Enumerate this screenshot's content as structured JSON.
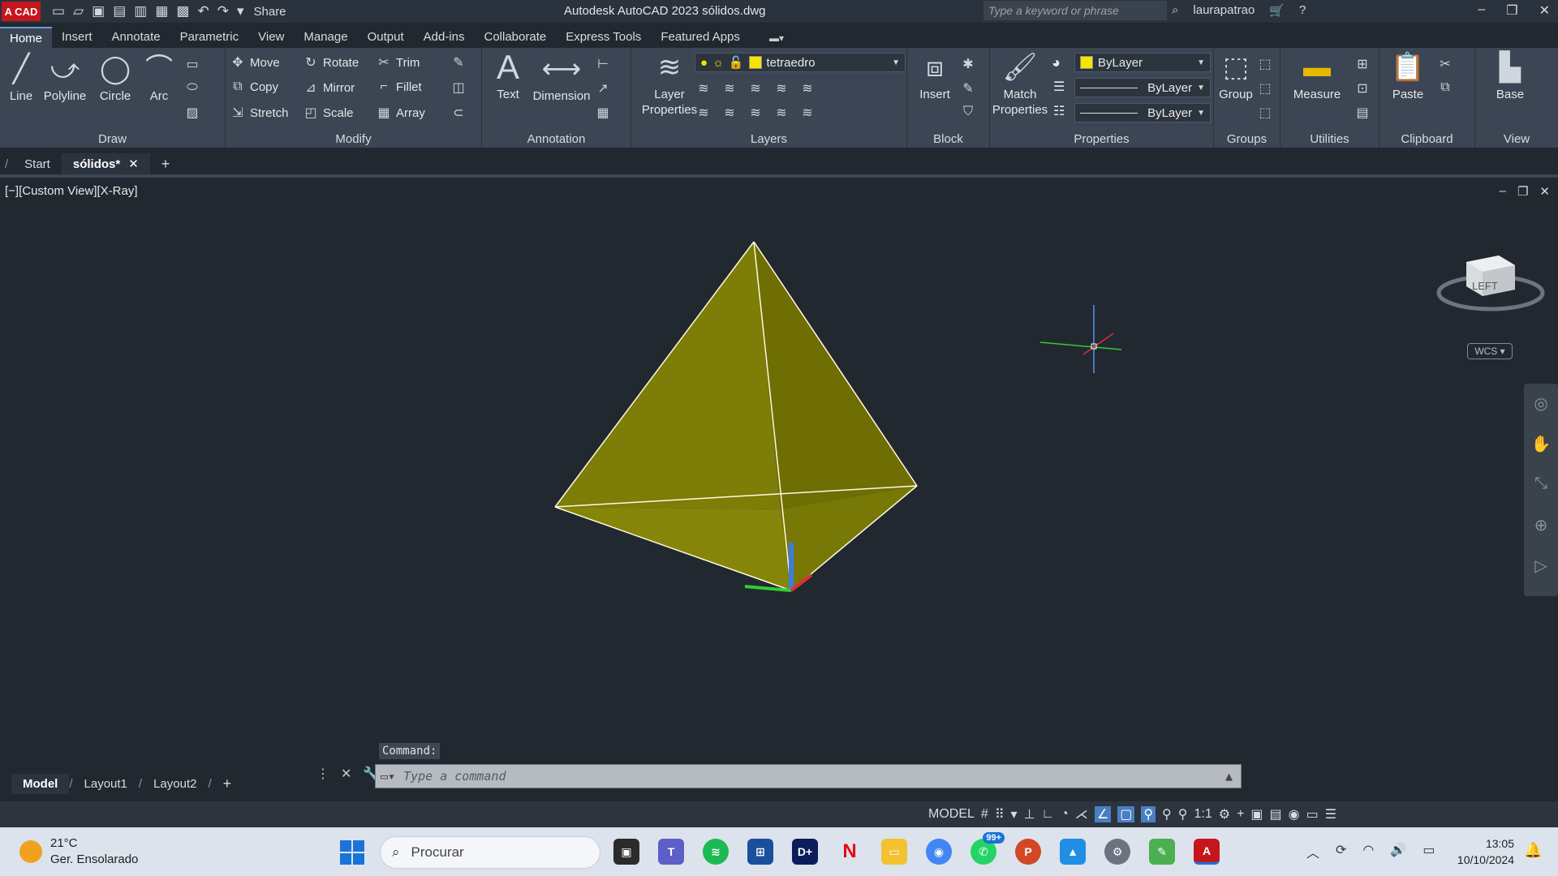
{
  "titlebar": {
    "logo": "A CAD",
    "share": "Share",
    "app_title": "Autodesk AutoCAD 2023   sólidos.dwg",
    "search_placeholder": "Type a keyword or phrase",
    "user": "laurapatrao"
  },
  "ribbon_tabs": [
    "Home",
    "Insert",
    "Annotate",
    "Parametric",
    "View",
    "Manage",
    "Output",
    "Add-ins",
    "Collaborate",
    "Express Tools",
    "Featured Apps"
  ],
  "ribbon": {
    "draw": {
      "title": "Draw",
      "line": "Line",
      "polyline": "Polyline",
      "circle": "Circle",
      "arc": "Arc"
    },
    "modify": {
      "title": "Modify",
      "move": "Move",
      "rotate": "Rotate",
      "trim": "Trim",
      "copy": "Copy",
      "mirror": "Mirror",
      "fillet": "Fillet",
      "stretch": "Stretch",
      "scale": "Scale",
      "array": "Array"
    },
    "annotation": {
      "title": "Annotation",
      "text": "Text",
      "dimension": "Dimension"
    },
    "layers": {
      "title": "Layers",
      "layer_properties_1": "Layer",
      "layer_properties_2": "Properties",
      "current_layer": "tetraedro"
    },
    "block": {
      "title": "Block",
      "insert": "Insert"
    },
    "properties": {
      "title": "Properties",
      "match_1": "Match",
      "match_2": "Properties",
      "color": "ByLayer",
      "linetype": "ByLayer",
      "lineweight": "ByLayer"
    },
    "groups": {
      "title": "Groups",
      "group": "Group"
    },
    "utilities": {
      "title": "Utilities",
      "measure": "Measure"
    },
    "clipboard": {
      "title": "Clipboard",
      "paste": "Paste"
    },
    "view": {
      "title": "View",
      "base": "Base"
    }
  },
  "doc_tabs": {
    "start": "Start",
    "active": "sólidos*"
  },
  "viewport": {
    "label": "[−][Custom View][X-Ray]",
    "cube_face": "LEFT",
    "wcs": "WCS"
  },
  "command": {
    "history": "Command:",
    "placeholder": "Type a command"
  },
  "layout_tabs": [
    "Model",
    "Layout1",
    "Layout2"
  ],
  "status": {
    "model": "MODEL",
    "scale": "1:1"
  },
  "taskbar": {
    "temp": "21°C",
    "weather": "Ger. Ensolarado",
    "search": "Procurar",
    "whatsapp_badge": "99+",
    "time": "13:05",
    "date": "10/10/2024"
  },
  "colors": {
    "solid_fill": "#7a7a0a",
    "edge": "#ffffe0",
    "accent": "#4a7fc1"
  }
}
